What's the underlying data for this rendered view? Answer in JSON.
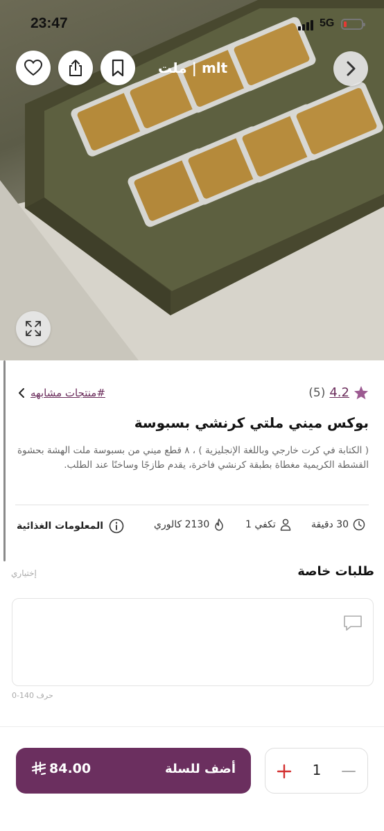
{
  "status_bar": {
    "time": "23:47",
    "network": "5G"
  },
  "header": {
    "title": "ملت | mlt"
  },
  "icons": {
    "favorite": "heart-icon",
    "share": "share-icon",
    "bookmark": "bookmark-icon",
    "next": "chevron-right-icon",
    "expand": "expand-icon",
    "star": "star-icon",
    "back_similar": "chevron-left-icon",
    "clock": "clock-icon",
    "serves": "person-icon",
    "calories": "flame-icon",
    "info": "info-icon",
    "message": "message-icon",
    "plus": "plus-icon",
    "minus": "minus-icon",
    "currency": "riyal-icon"
  },
  "product": {
    "rating": "4.2",
    "rating_count": "(5)",
    "similar_link": "#منتجات مشابهه",
    "title": "بوكس ميني ملتي كرنشي بسبوسة",
    "description": "( الكتابة في كرت خارجي وباللغة الإنجليزية ) ، ٨ قطع ميني من بسبوسة ملت الهشة بحشوة القشطة الكريمية مغطاة بطبقة كرنشي فاخرة، يقدم طازجًا وساخنًا عند الطلب.",
    "prep_time": "30 دقيقة",
    "serves": "تكفي 1",
    "calories": "2130 كالوري",
    "nutrition_label": "المعلومات الغذائية"
  },
  "special_requests": {
    "title": "طلبات خاصة",
    "optional_label": "إختياري",
    "value": "",
    "char_limit": "0-140 حرف"
  },
  "cart": {
    "add_label": "أضف للسلة",
    "price": "84.00",
    "quantity": "1"
  },
  "colors": {
    "brand": "#6b2f5f",
    "star": "#9c5a91",
    "plus": "#d32f2f",
    "battery_low": "#e53935"
  }
}
